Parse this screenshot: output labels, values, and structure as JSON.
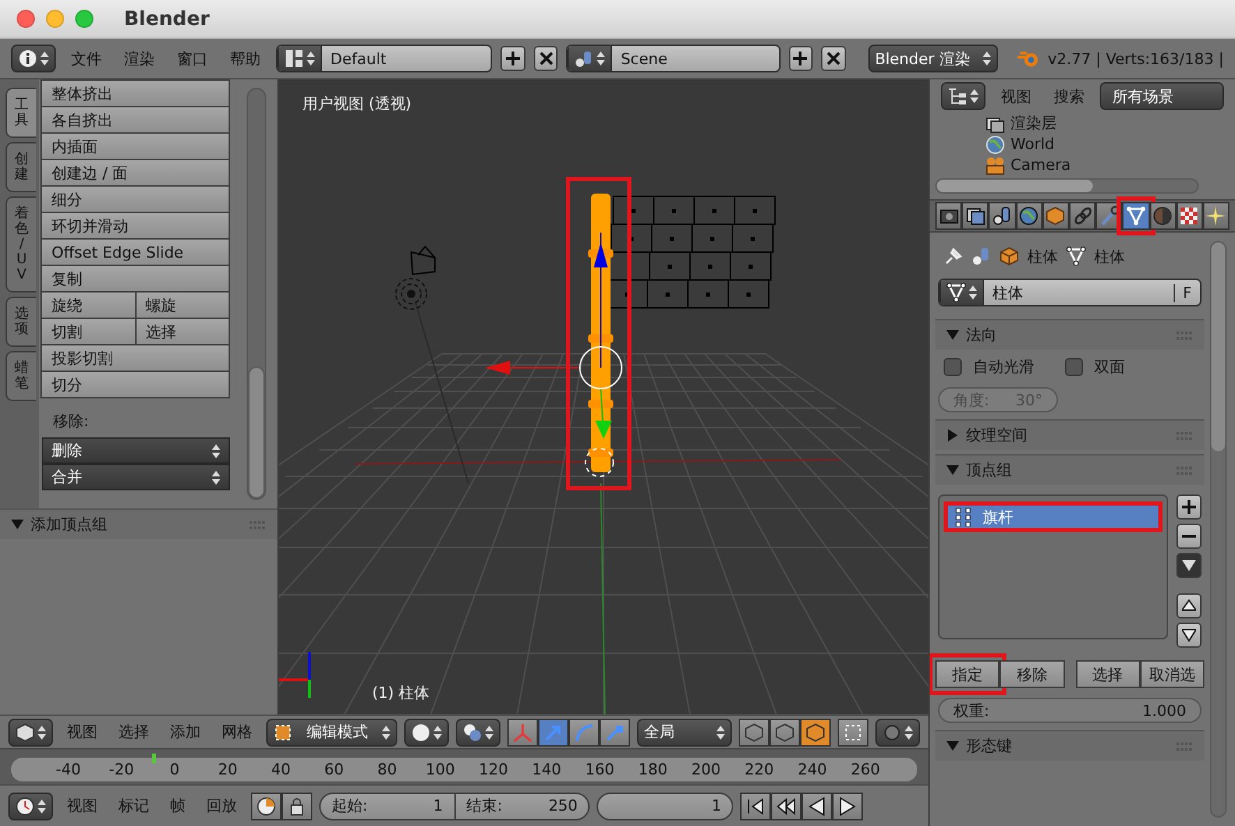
{
  "window": {
    "title": "Blender"
  },
  "info_header": {
    "menus": [
      "文件",
      "渲染",
      "窗口",
      "帮助"
    ],
    "layout": "Default",
    "scene": "Scene",
    "render_engine": "Blender 渲染",
    "stats": "v2.77 | Verts:163/183 |"
  },
  "tool_shelf": {
    "tabs": [
      {
        "label": "工具",
        "selected": true
      },
      {
        "label": "创建",
        "selected": false
      },
      {
        "label": "着色 / UV",
        "selected": false
      },
      {
        "label": "选项",
        "selected": false
      },
      {
        "label": "蜡笔",
        "selected": false
      }
    ],
    "tool_rows": [
      [
        "整体挤出"
      ],
      [
        "各自挤出"
      ],
      [
        "内插面"
      ],
      [
        "创建边 / 面"
      ],
      [
        "细分"
      ],
      [
        "环切并滑动"
      ],
      [
        "Offset Edge Slide"
      ],
      [
        "复制"
      ],
      [
        "旋绕",
        "螺旋"
      ],
      [
        "切割",
        "选择"
      ],
      [
        "投影切割"
      ],
      [
        "切分"
      ]
    ],
    "remove_label": "移除:",
    "remove_menus": [
      "删除",
      "合并"
    ],
    "panel": {
      "title": "添加顶点组",
      "expanded": true
    }
  },
  "viewport": {
    "view_name": "用户视图 (透视)",
    "object_label": "(1) 柱体",
    "pole_annotated": true
  },
  "viewport_header": {
    "menus": [
      "视图",
      "选择",
      "添加",
      "网格"
    ],
    "mode": "编辑模式",
    "orientation": "全局",
    "manipulators": [
      {
        "selected": false
      },
      {
        "selected": true
      },
      {
        "selected": false
      },
      {
        "selected": false
      }
    ],
    "select_modes": [
      {
        "selected": false
      },
      {
        "selected": false
      },
      {
        "selected": true
      }
    ]
  },
  "timeline": {
    "ticks": [
      "-40",
      "-20",
      "0",
      "20",
      "40",
      "60",
      "80",
      "100",
      "120",
      "140",
      "160",
      "180",
      "200",
      "220",
      "240",
      "260"
    ],
    "playhead": {
      "level": 0.163
    }
  },
  "timeline_header": {
    "menus": [
      "视图",
      "标记",
      "帧",
      "回放"
    ],
    "start_label": "起始:",
    "start": "1",
    "end_label": "结束:",
    "end": "250",
    "current": "1"
  },
  "outliner": {
    "menus": [
      "视图",
      "搜索"
    ],
    "filter": "所有场景",
    "rows": [
      {
        "label": "渲染层"
      },
      {
        "label": "World"
      },
      {
        "label": "Camera"
      }
    ]
  },
  "properties": {
    "tabs": [
      {
        "selected": false,
        "annotated": false
      },
      {
        "selected": false,
        "annotated": false
      },
      {
        "selected": false,
        "annotated": false
      },
      {
        "selected": false,
        "annotated": false
      },
      {
        "selected": false,
        "annotated": false
      },
      {
        "selected": false,
        "annotated": false
      },
      {
        "selected": false,
        "annotated": false
      },
      {
        "selected": true,
        "annotated": true
      },
      {
        "selected": false,
        "annotated": false
      },
      {
        "selected": false,
        "annotated": false
      },
      {
        "selected": false,
        "annotated": false
      }
    ],
    "breadcrumb": [
      "柱体",
      "柱体"
    ],
    "datablock": "柱体",
    "fake_user": "F",
    "normals": {
      "title": "法向",
      "expanded": true,
      "auto_smooth": {
        "label": "自动光滑",
        "checked": false
      },
      "double_sided": {
        "label": "双面",
        "checked": false
      },
      "angle": {
        "label": "角度:",
        "value": "30°",
        "disabled": true
      }
    },
    "texture_space": {
      "title": "纹理空间",
      "expanded": false
    },
    "vertex_groups": {
      "title": "顶点组",
      "expanded": true,
      "items": [
        {
          "name": "旗杆",
          "selected": true,
          "annotated": true
        }
      ],
      "buttons": [
        {
          "label": "指定",
          "annotated": true
        },
        {
          "label": "移除",
          "annotated": false
        },
        {
          "label": "选择",
          "annotated": false
        },
        {
          "label": "取消选",
          "annotated": false
        }
      ],
      "weight": {
        "label": "权重:",
        "value": "1.000"
      }
    },
    "shape_keys": {
      "title": "形态键",
      "expanded": true
    }
  }
}
